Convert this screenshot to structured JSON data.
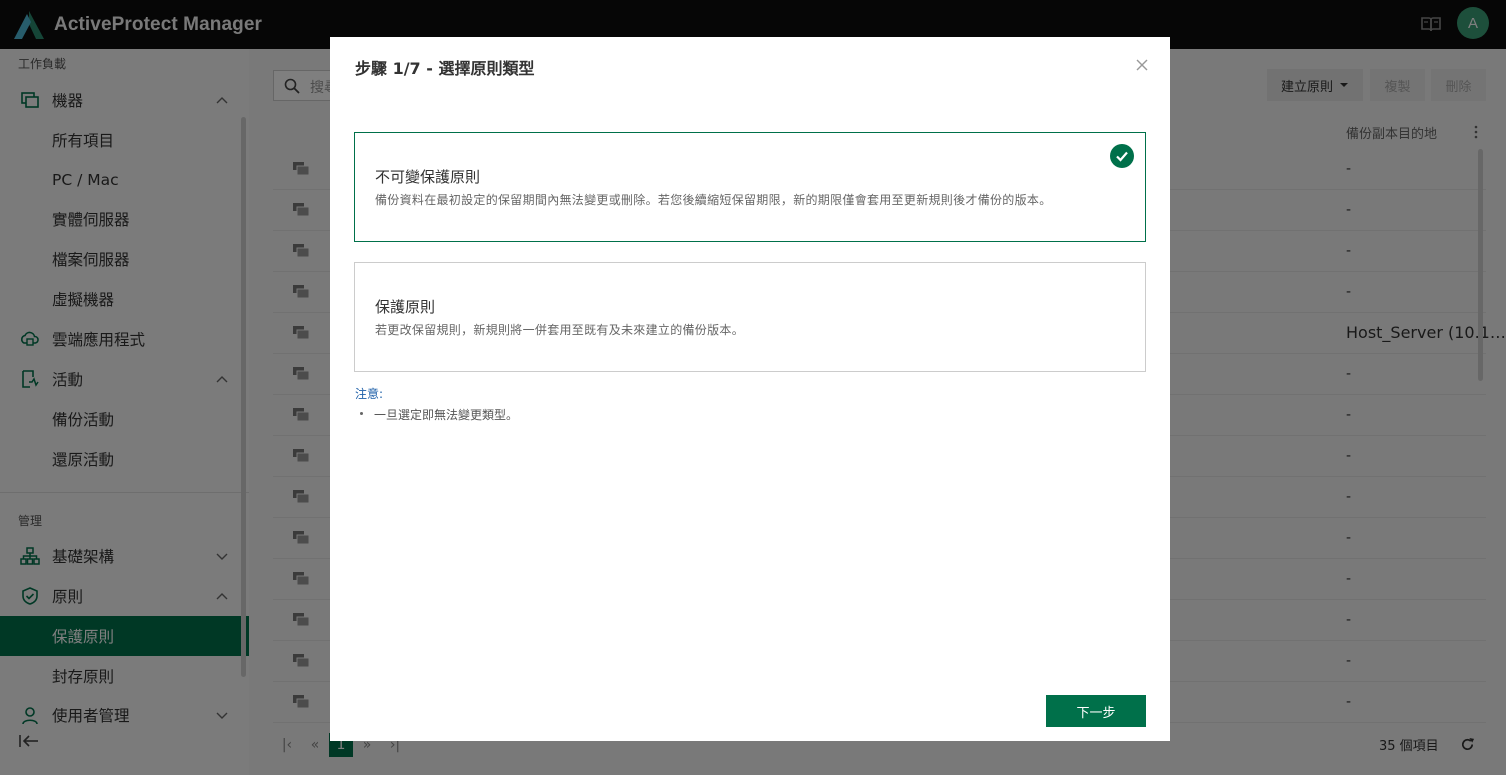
{
  "app": {
    "title": "ActiveProtect Manager",
    "avatar_letter": "A",
    "brand_color": "#00704a"
  },
  "sidebar": {
    "section_workload": "工作負載",
    "section_manage": "管理",
    "items": [
      {
        "label": "機器",
        "icon": "machine-icon"
      },
      {
        "label": "所有項目"
      },
      {
        "label": "PC / Mac"
      },
      {
        "label": "實體伺服器"
      },
      {
        "label": "檔案伺服器"
      },
      {
        "label": "虛擬機器"
      },
      {
        "label": "雲端應用程式",
        "icon": "cloud-app-icon"
      },
      {
        "label": "活動",
        "icon": "activity-icon"
      },
      {
        "label": "備份活動"
      },
      {
        "label": "還原活動"
      },
      {
        "label": "基礎架構",
        "icon": "infrastructure-icon"
      },
      {
        "label": "原則",
        "icon": "shield-icon"
      },
      {
        "label": "保護原則"
      },
      {
        "label": "封存原則"
      },
      {
        "label": "使用者管理",
        "icon": "user-icon"
      }
    ]
  },
  "main": {
    "search_placeholder": "搜尋",
    "create_button": "建立原則",
    "copy_button": "複製",
    "delete_button": "刪除",
    "column_destination": "備份副本目的地",
    "rows": [
      "-",
      "-",
      "-",
      "-",
      "Host_Server (10.1…",
      "-",
      "-",
      "-",
      "-",
      "-",
      "-",
      "-",
      "-",
      "-"
    ],
    "pager": {
      "current_page": "1"
    },
    "item_count": "35 個項目"
  },
  "modal": {
    "title": "步驟 1/7 - 選擇原則類型",
    "option_immutable": {
      "title": "不可變保護原則",
      "description": "備份資料在最初設定的保留期間內無法變更或刪除。若您後續縮短保留期限，新的期限僅會套用至更新規則後才備份的版本。"
    },
    "option_protection": {
      "title": "保護原則",
      "description": "若更改保留規則，新規則將一併套用至既有及未來建立的備份版本。"
    },
    "note_label": "注意:",
    "note_item": "一旦選定即無法變更類型。",
    "next_button": "下一步"
  }
}
